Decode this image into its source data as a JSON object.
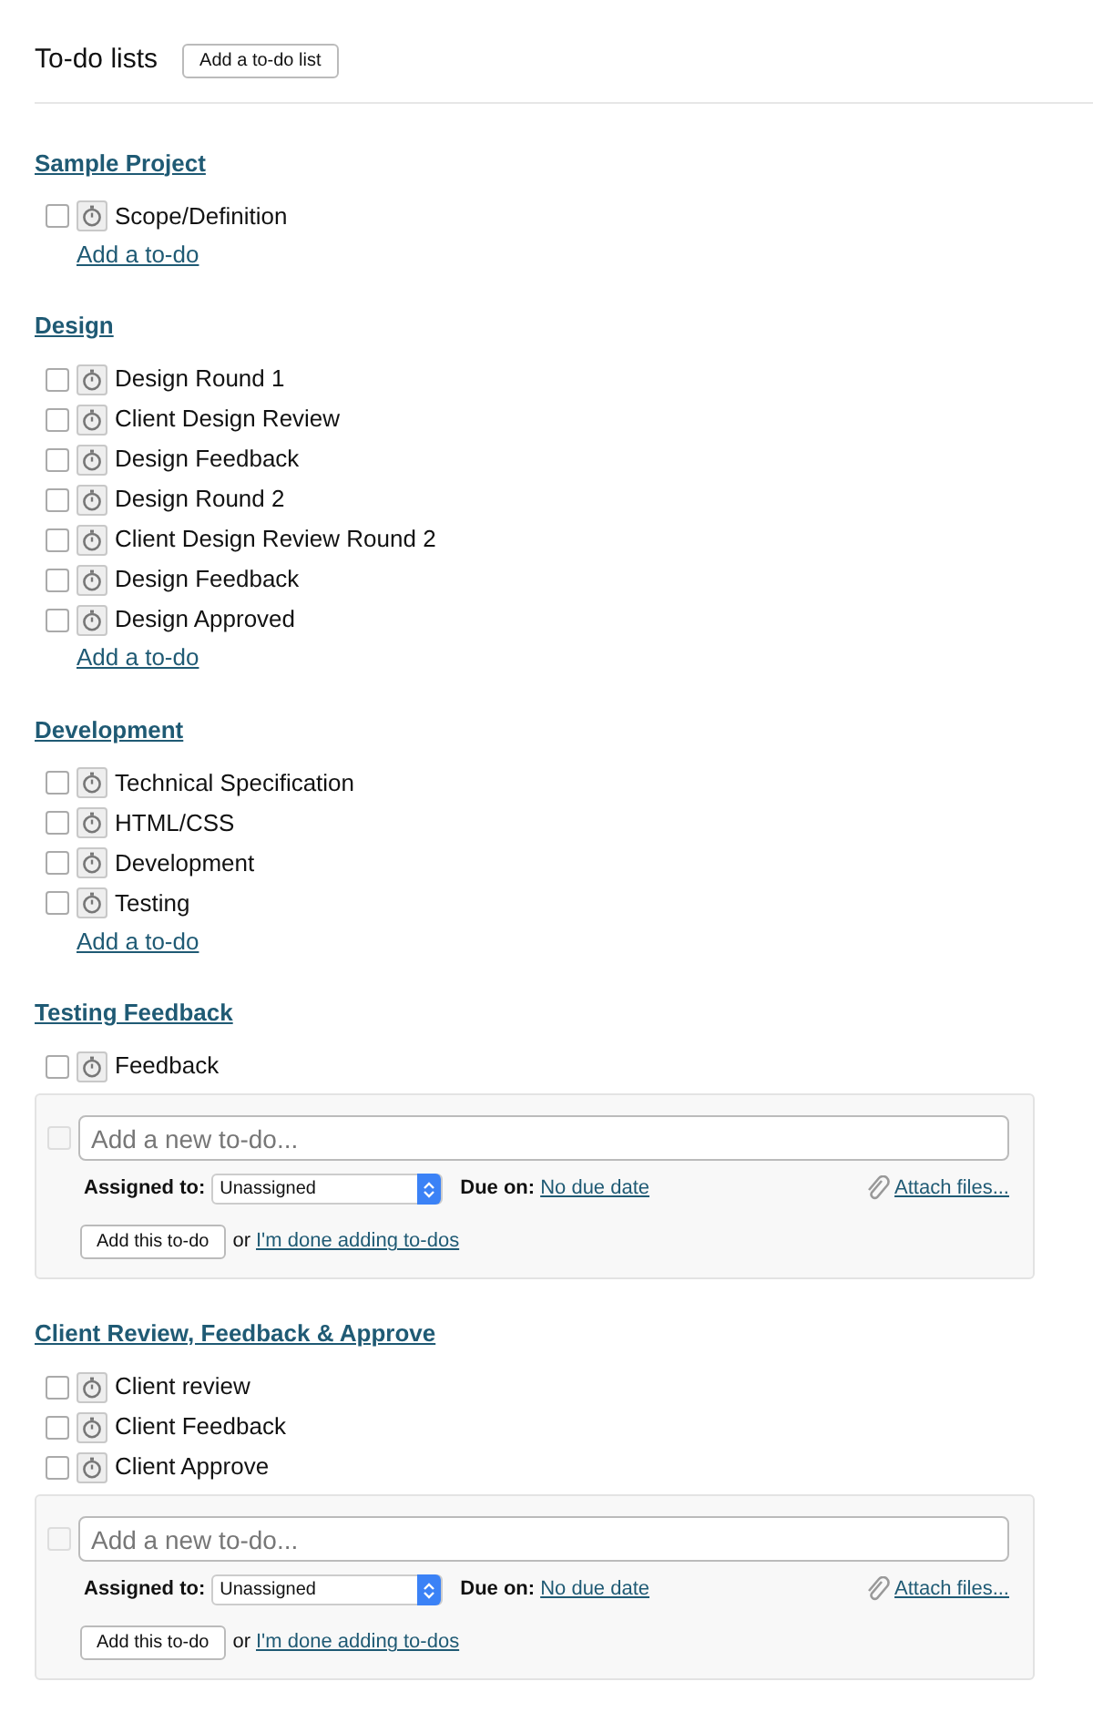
{
  "header": {
    "title": "To-do lists",
    "button": "Add a to-do list"
  },
  "lists": [
    {
      "title": "Sample Project",
      "items": [
        {
          "label": "Scope/Definition",
          "checked": false
        }
      ],
      "add_link": "Add a to-do"
    },
    {
      "title": "Design",
      "items": [
        {
          "label": "Design Round 1",
          "checked": false
        },
        {
          "label": "Client Design Review",
          "checked": false
        },
        {
          "label": "Design Feedback",
          "checked": false
        },
        {
          "label": "Design Round 2",
          "checked": false
        },
        {
          "label": "Client Design Review Round 2",
          "checked": false
        },
        {
          "label": "Design Feedback",
          "checked": false
        },
        {
          "label": "Design Approved",
          "checked": false
        }
      ],
      "add_link": "Add a to-do"
    },
    {
      "title": "Development",
      "items": [
        {
          "label": "Technical Specification",
          "checked": false
        },
        {
          "label": "HTML/CSS",
          "checked": false
        },
        {
          "label": "Development",
          "checked": false
        },
        {
          "label": "Testing",
          "checked": false
        }
      ],
      "add_link": "Add a to-do"
    },
    {
      "title": "Testing Feedback",
      "items": [
        {
          "label": "Feedback",
          "checked": false
        }
      ],
      "form": {
        "checkbox_disabled": true,
        "placeholder": "Add a new to-do...",
        "assigned_label": "Assigned to:",
        "assignee": "Unassigned",
        "due_label": "Due on:",
        "due_value": "No due date",
        "attach": "Attach files...",
        "submit": "Add this to-do",
        "or_text": "or",
        "done_link": "I'm done adding to-dos"
      }
    },
    {
      "title": "Client Review, Feedback & Approve",
      "items": [
        {
          "label": "Client review",
          "checked": false
        },
        {
          "label": "Client Feedback",
          "checked": false
        },
        {
          "label": "Client Approve",
          "checked": false
        }
      ],
      "form": {
        "checkbox_disabled": true,
        "placeholder": "Add a new to-do...",
        "assigned_label": "Assigned to:",
        "assignee": "Unassigned",
        "due_label": "Due on:",
        "due_value": "No due date",
        "attach": "Attach files...",
        "submit": "Add this to-do",
        "or_text": "or",
        "done_link": "I'm done adding to-dos"
      }
    }
  ]
}
